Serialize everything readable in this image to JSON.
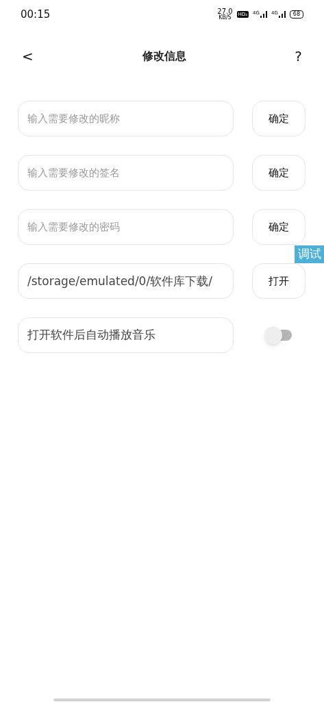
{
  "status_bar": {
    "time": "00:15",
    "speed": "27.0",
    "speed_unit": "KB/S",
    "hd": "HD₂",
    "net_1": "4G",
    "net_2": "4G",
    "battery": "68"
  },
  "header": {
    "back": "<",
    "title": "修改信息",
    "help": "?"
  },
  "rows": [
    {
      "kind": "input",
      "placeholder": "输入需要修改的昵称",
      "button": "确定"
    },
    {
      "kind": "input",
      "placeholder": "输入需要修改的签名",
      "button": "确定"
    },
    {
      "kind": "input",
      "placeholder": "输入需要修改的密码",
      "button": "确定"
    },
    {
      "kind": "path",
      "value": "/storage/emulated/0/软件库下载/",
      "button": "打开"
    },
    {
      "kind": "toggle",
      "label": "打开软件后自动播放音乐",
      "on": false
    }
  ],
  "debug_tag": "调试"
}
